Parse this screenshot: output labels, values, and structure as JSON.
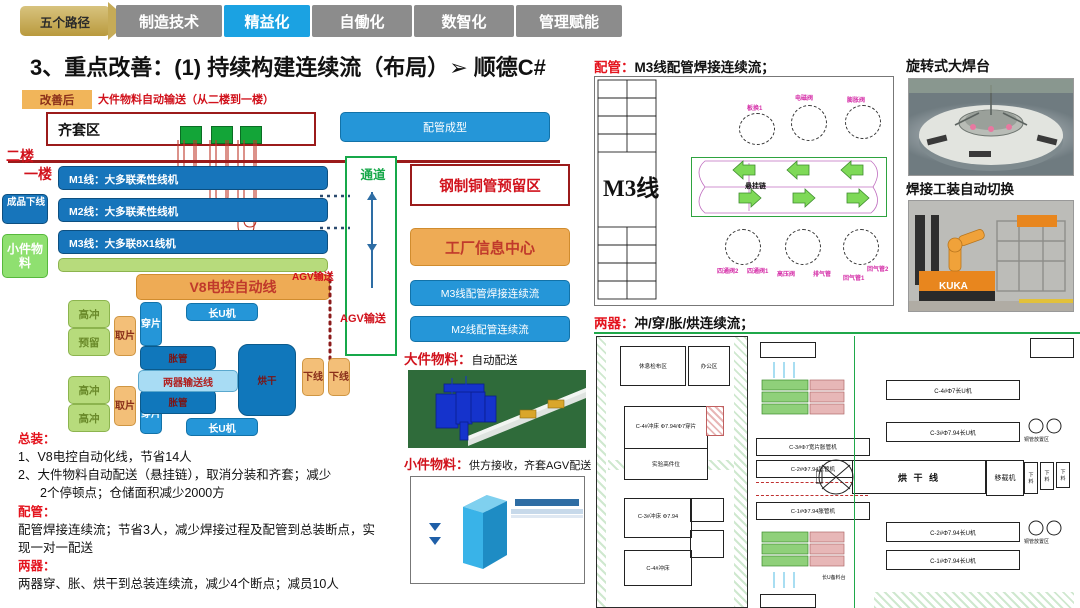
{
  "tabs": {
    "path_badge": "五个路径",
    "items": [
      {
        "label": "制造技术",
        "active": false
      },
      {
        "label": "精益化",
        "active": true
      },
      {
        "label": "自働化",
        "active": false
      },
      {
        "label": "数智化",
        "active": false
      },
      {
        "label": "管理赋能",
        "active": false
      }
    ],
    "active_color": "#1ba2e2",
    "inactive_color": "#8c8c8c"
  },
  "heading": {
    "index": "3、重点改善：",
    "body": "(1) 持续构建连续流（布局）➢  顺德C#"
  },
  "left_diagram": {
    "after_badge": "改善后",
    "top_note": "大件物料自动输送（从二楼到一楼）",
    "qitao_zone": "齐套区",
    "floor_upper": "二楼",
    "floor_lower": "一楼",
    "finished_offline": "成品下线",
    "small_parts": "小件物料",
    "lines": [
      "M1线：大多联柔性线机",
      "M2线：大多联柔性线机",
      "M3线：大多联8X1线机"
    ],
    "v8_line": "V8电控自动线",
    "pipe_forming": "配管成型",
    "channel": "通道",
    "steel_copper_zone": "钢制铜管预留区",
    "factory_info_center": "工厂信息中心",
    "m3_weld_flow": "M3线配管焊接连续流",
    "m2_pipe_flow": "M2线配管连续流",
    "agv_label_1": "AGV输送",
    "agv_label_2": "AGV输送",
    "press_a": "高冲",
    "press_b": "预留",
    "press_c": "高冲",
    "press_d": "高冲",
    "pick": "取片",
    "thread": "穿片",
    "expand": "胀管",
    "conveyor": "两器输送线",
    "dryer": "烘干",
    "offline": "下线",
    "long_u_top": "长U机",
    "long_u_bottom": "长U机"
  },
  "material_notes": {
    "big_label": "大件物料：",
    "big_value": "自动配送",
    "small_label": "小件物料：",
    "small_value": "供方接收，齐套AGV配送"
  },
  "notes": {
    "assembly_head": "总装：",
    "assembly_lines": [
      "1、V8电控自动化线，节省14人",
      "2、大件物料自动配送（悬挂链），取消分装和齐套；减少",
      "2个停顿点；仓储面积减少2000方"
    ],
    "piping_head": "配管：",
    "piping_lines": [
      "配管焊接连续流；节省3人，减少焊接过程及配管到总装断点，实",
      "现一对一配送"
    ],
    "devices_head": "两器：",
    "devices_lines": [
      "两器穿、胀、烘干到总装连续流，减少4个断点；减员10人"
    ]
  },
  "panel_piping": {
    "title_red": "配管：",
    "title_rest": "M3线配管焊接连续流；",
    "cad_title": "M3线",
    "top_labels": [
      "板换1",
      "电磁阀",
      "膨胀阀"
    ],
    "bottom_labels": [
      "四通阀2",
      "四通阀1",
      "高压阀",
      "排气管",
      "回气管1",
      "回气管2"
    ],
    "center_label": "悬挂链"
  },
  "panel_devices": {
    "title_red": "两器：",
    "title_rest": "冲/穿/胀/烘连续流；",
    "rooms": [
      "休息检布区",
      "办公区",
      "C-4#冲床 Φ7.94/Φ7穿片",
      "实验高件位",
      "C-3#冲床 Φ7.94",
      "C-4#冲床"
    ],
    "machines": [
      "C-3#Φ7宽片胀管机",
      "C-2#Φ7.94胀管机",
      "C-1#Φ7.94胀管机",
      "C-4#Φ7长U机",
      "C-3#Φ7.94长U机",
      "C-2#Φ7.94长U机",
      "C-1#Φ7.94长U机"
    ],
    "dry_line": "烘 干 线",
    "transfer": "移载机",
    "copper_zone_1": "铜管放置区",
    "copper_zone_2": "铜管放置区",
    "stage": "长U备料台",
    "side_label": "下 料"
  },
  "photos": {
    "weld_title": "旋转式大焊台",
    "tooling_title": "焊接工装自动切换",
    "robot_brand": "KUKA"
  }
}
